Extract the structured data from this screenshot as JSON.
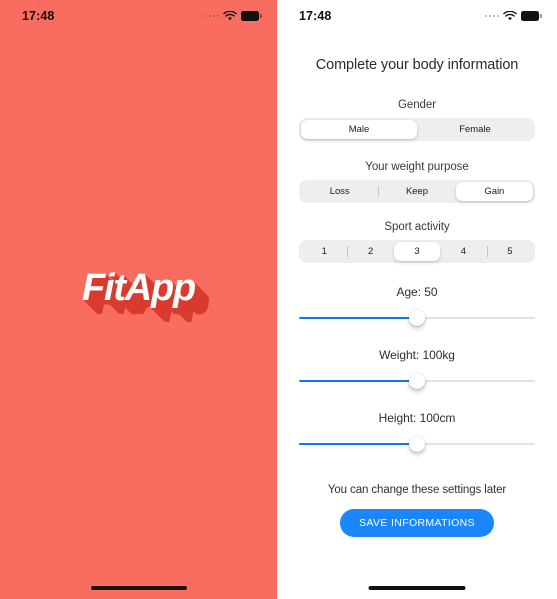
{
  "splash": {
    "background_color": "#f96d60",
    "shadow_color": "#d93b2f",
    "logo_text": "FitApp",
    "statusbar": {
      "time": "17:48"
    }
  },
  "form": {
    "statusbar": {
      "time": "17:48"
    },
    "title": "Complete your body information",
    "gender": {
      "label": "Gender",
      "options": [
        "Male",
        "Female"
      ],
      "selected_index": 0
    },
    "weight_purpose": {
      "label": "Your weight purpose",
      "options": [
        "Loss",
        "Keep",
        "Gain"
      ],
      "selected_index": 2
    },
    "sport_activity": {
      "label": "Sport activity",
      "options": [
        "1",
        "2",
        "3",
        "4",
        "5"
      ],
      "selected_index": 2
    },
    "sliders": [
      {
        "label": "Age: 50",
        "percent": 50,
        "accent": "#0a78f0"
      },
      {
        "label": "Weight: 100kg",
        "percent": 50,
        "accent": "#0a78f0"
      },
      {
        "label": "Height: 100cm",
        "percent": 50,
        "accent": "#0a78f0"
      }
    ],
    "footer_note": "You can change these settings later",
    "save_button": "SAVE INFORMATIONS",
    "save_button_color": "#1a86fb"
  }
}
